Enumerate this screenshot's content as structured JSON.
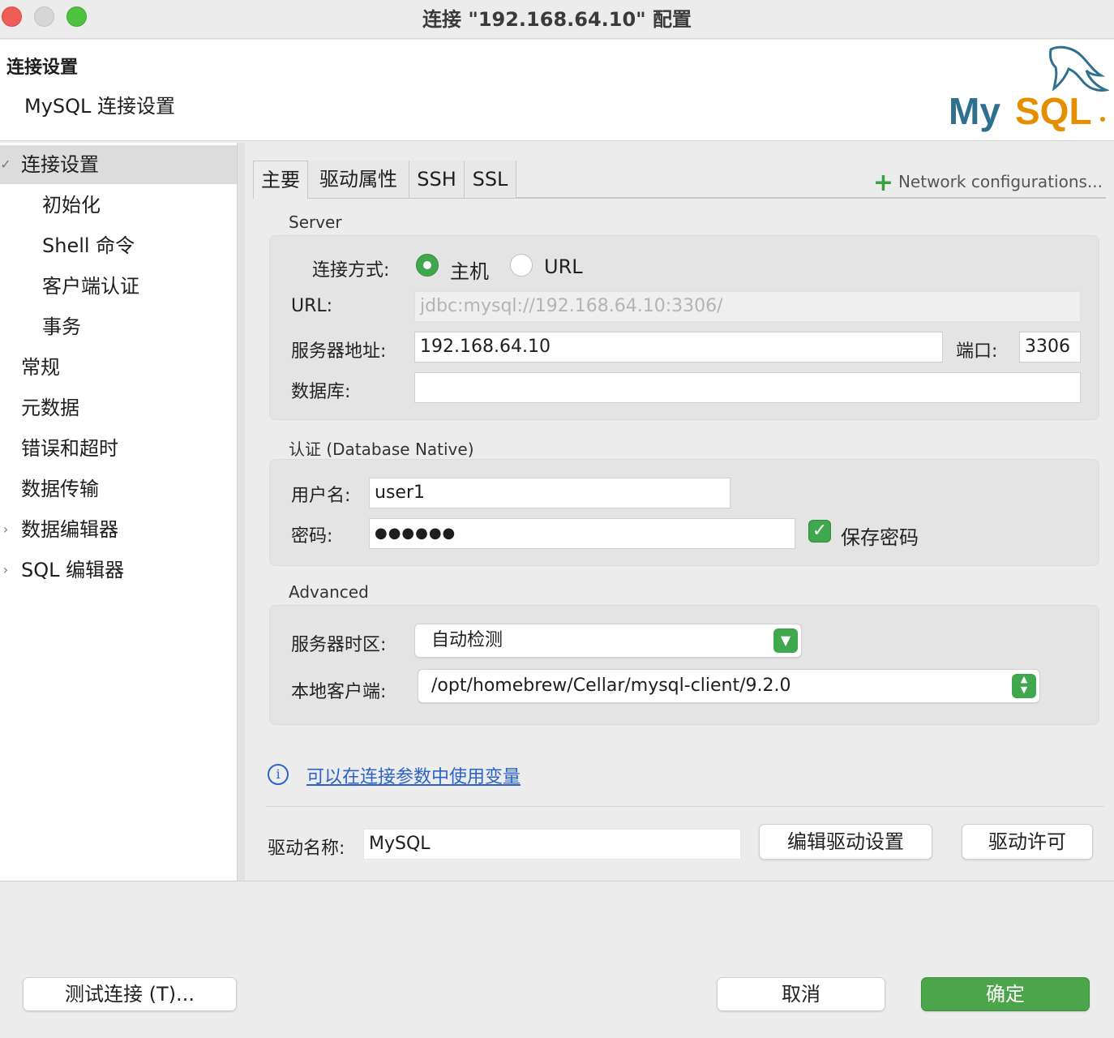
{
  "window": {
    "title": "连接 \"192.168.64.10\" 配置"
  },
  "header": {
    "title": "连接设置",
    "subtitle": "MySQL 连接设置",
    "logo_text": "MySQL"
  },
  "sidebar": {
    "items": [
      {
        "label": "连接设置",
        "arrow": "✓",
        "selected": true
      },
      {
        "label": "初始化"
      },
      {
        "label": "Shell 命令"
      },
      {
        "label": "客户端认证"
      },
      {
        "label": "事务"
      },
      {
        "label": "常规"
      },
      {
        "label": "元数据"
      },
      {
        "label": "错误和超时"
      },
      {
        "label": "数据传输"
      },
      {
        "label": "数据编辑器",
        "arrow": "›"
      },
      {
        "label": "SQL 编辑器",
        "arrow": "›"
      }
    ]
  },
  "tabs": [
    {
      "label": "主要"
    },
    {
      "label": "驱动属性"
    },
    {
      "label": "SSH"
    },
    {
      "label": "SSL"
    }
  ],
  "network_config": {
    "label": "Network configurations..."
  },
  "server": {
    "title": "Server",
    "conn_method_label": "连接方式:",
    "option_host": "主机",
    "option_url": "URL",
    "url_label": "URL:",
    "url_value": "jdbc:mysql://192.168.64.10:3306/",
    "host_label": "服务器地址:",
    "host_value": "192.168.64.10",
    "port_label": "端口:",
    "port_value": "3306",
    "db_label": "数据库:",
    "db_value": ""
  },
  "auth": {
    "title": "认证 (Database Native)",
    "user_label": "用户名:",
    "user_value": "user1",
    "pwd_label": "密码:",
    "pwd_value": "●●●●●●",
    "save_pwd_label": "保存密码"
  },
  "advanced": {
    "title": "Advanced",
    "tz_label": "服务器时区:",
    "tz_value": "自动检测",
    "client_label": "本地客户端:",
    "client_value": "/opt/homebrew/Cellar/mysql-client/9.2.0"
  },
  "info": {
    "link": "可以在连接参数中使用变量"
  },
  "driver": {
    "name_label": "驱动名称:",
    "name_value": "MySQL",
    "edit_btn": "编辑驱动设置",
    "license_btn": "驱动许可"
  },
  "footer": {
    "test_btn": "测试连接 (T)...",
    "cancel_btn": "取消",
    "ok_btn": "确定"
  },
  "colors": {
    "accent": "#4ca54a",
    "link": "#2d63c8",
    "mysql_blue": "#2f6f8f",
    "mysql_orange": "#e48e00"
  }
}
